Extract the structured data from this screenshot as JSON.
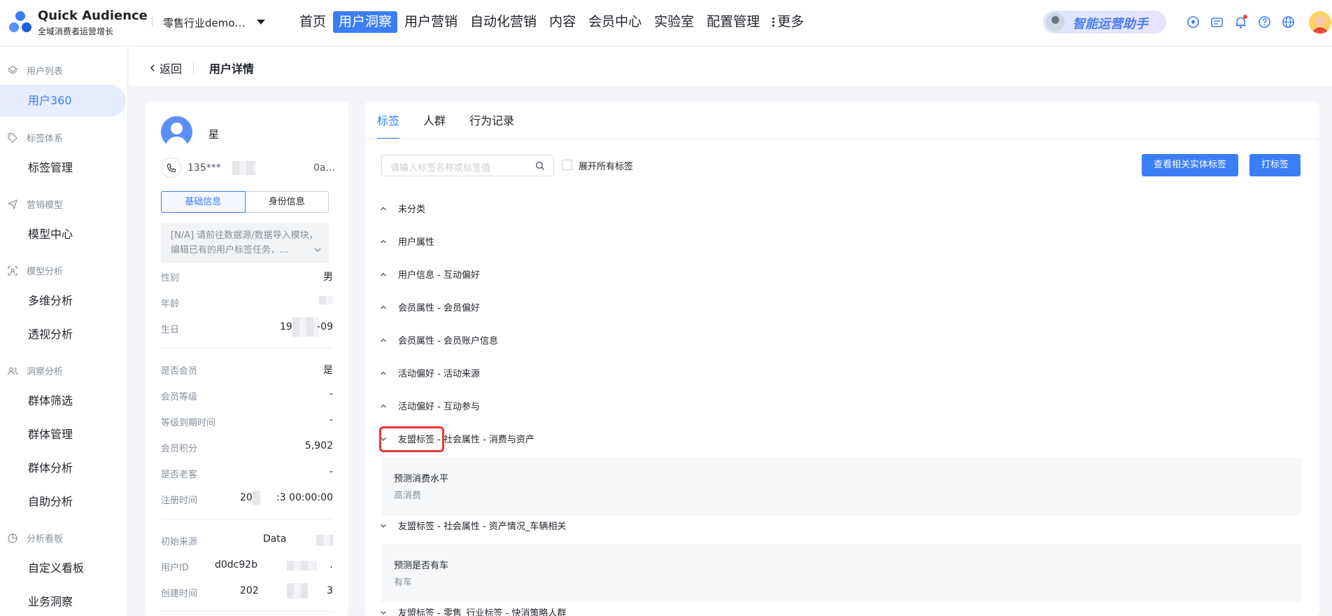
{
  "brand": {
    "name": "Quick Audience",
    "subtitle": "全域消费者运营增长"
  },
  "tenant": "零售行业demo…",
  "nav": [
    {
      "label": "首页",
      "active": false
    },
    {
      "label": "用户洞察",
      "active": true
    },
    {
      "label": "用户营销",
      "active": false
    },
    {
      "label": "自动化营销",
      "active": false
    },
    {
      "label": "内容",
      "active": false
    },
    {
      "label": "会员中心",
      "active": false
    },
    {
      "label": "实验室",
      "active": false
    },
    {
      "label": "配置管理",
      "active": false
    }
  ],
  "nav_more": "更多",
  "assistant": "智能运营助手",
  "sidebar": {
    "groups": [
      {
        "label": "用户列表",
        "icon": "layers-icon",
        "items": [
          "用户360"
        ]
      },
      {
        "label": "标签体系",
        "icon": "tag-icon",
        "items": [
          "标签管理"
        ]
      },
      {
        "label": "营销模型",
        "icon": "send-icon",
        "items": [
          "模型中心"
        ]
      },
      {
        "label": "模型分析",
        "icon": "scan-icon",
        "items": [
          "多维分析",
          "透视分析"
        ]
      },
      {
        "label": "洞察分析",
        "icon": "users-icon",
        "items": [
          "群体筛选",
          "群体管理",
          "群体分析",
          "自助分析"
        ]
      },
      {
        "label": "分析看板",
        "icon": "dashboard-icon",
        "items": [
          "自定义看板",
          "业务洞察"
        ]
      }
    ],
    "active_item": "用户360"
  },
  "page": {
    "back": "返回",
    "title": "用户详情"
  },
  "profile": {
    "name": "星",
    "phone": "135***",
    "phone_tail": "0a...",
    "tabs": [
      "基础信息",
      "身份信息"
    ],
    "notice": "[N/A] 请前往数据源/数据导入模块，编辑已有的用户标签任务，...",
    "fields": {
      "gender": {
        "label": "性别",
        "value": "男"
      },
      "age": {
        "label": "年龄",
        "value": ""
      },
      "birthday": {
        "label": "生日",
        "value_a": "19",
        "value_b": "-09"
      },
      "is_member": {
        "label": "是否会员",
        "value": "是"
      },
      "level": {
        "label": "会员等级",
        "value": "-"
      },
      "level_expire": {
        "label": "等级到期时间",
        "value": "-"
      },
      "points": {
        "label": "会员积分",
        "value": "5,902"
      },
      "is_old": {
        "label": "是否老客",
        "value": "-"
      },
      "register": {
        "label": "注册时间",
        "value_a": "20",
        "value_b": ":3 00:00:00"
      },
      "source": {
        "label": "初始来源",
        "value": "Data"
      },
      "user_id": {
        "label": "用户ID",
        "value": "d0dc92b",
        "value_b": "."
      },
      "created": {
        "label": "创建时间",
        "value": "202",
        "value_b": "3"
      }
    }
  },
  "panel": {
    "tabs": [
      "标签",
      "人群",
      "行为记录"
    ],
    "active_tab": "标签",
    "search_placeholder": "请输入标签名称或标签值",
    "expand_all": "展开所有标签",
    "btn_entity": "查看相关实体标签",
    "btn_tag": "打标签",
    "categories": [
      {
        "label": "未分类",
        "expanded": false
      },
      {
        "label": "用户属性",
        "expanded": false
      },
      {
        "label": "用户信息 - 互动偏好",
        "expanded": false
      },
      {
        "label": "会员属性 - 会员偏好",
        "expanded": false
      },
      {
        "label": "会员属性 - 会员账户信息",
        "expanded": false
      },
      {
        "label": "活动偏好 - 活动来源",
        "expanded": false
      },
      {
        "label": "活动偏好 - 互动参与",
        "expanded": false
      },
      {
        "label": "友盟标签 - 社会属性 - 消费与资产",
        "expanded": true,
        "tag": {
          "name": "预测消费水平",
          "value": "高消费"
        }
      },
      {
        "label": "友盟标签 - 社会属性 - 资产情况_车辆相关",
        "expanded": true,
        "tag": {
          "name": "预测是否有车",
          "value": "有车"
        }
      },
      {
        "label": "友盟标签 - 零售_行业标签 - 快消策略人群",
        "expanded": true
      }
    ]
  },
  "colors": {
    "accent": "#3b7ef6",
    "highlight": "#e53935"
  }
}
